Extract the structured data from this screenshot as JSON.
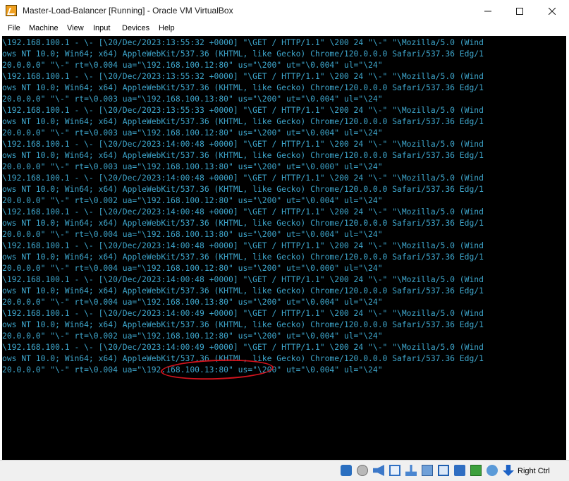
{
  "window": {
    "title": "Master-Load-Balancer [Running] - Oracle VM VirtualBox"
  },
  "menu": [
    "File",
    "Machine",
    "View",
    "Input",
    "Devices",
    "Help"
  ],
  "terminal": {
    "lines": [
      "\\192.168.100.1 - \\- [\\20/Dec/2023:13:55:32 +0000] \"\\GET / HTTP/1.1\" \\200 24 \"\\-\" \"\\Mozilla/5.0 (Wind",
      "ows NT 10.0; Win64; x64) AppleWebKit/537.36 (KHTML, like Gecko) Chrome/120.0.0.0 Safari/537.36 Edg/1",
      "20.0.0.0\" \"\\-\" rt=\\0.004 ua=\"\\192.168.100.12:80\" us=\"\\200\" ut=\"\\0.004\" ul=\"\\24\"",
      "\\192.168.100.1 - \\- [\\20/Dec/2023:13:55:32 +0000] \"\\GET / HTTP/1.1\" \\200 24 \"\\-\" \"\\Mozilla/5.0 (Wind",
      "ows NT 10.0; Win64; x64) AppleWebKit/537.36 (KHTML, like Gecko) Chrome/120.0.0.0 Safari/537.36 Edg/1",
      "20.0.0.0\" \"\\-\" rt=\\0.003 ua=\"\\192.168.100.13:80\" us=\"\\200\" ut=\"\\0.004\" ul=\"\\24\"",
      "\\192.168.100.1 - \\- [\\20/Dec/2023:13:55:33 +0000] \"\\GET / HTTP/1.1\" \\200 24 \"\\-\" \"\\Mozilla/5.0 (Wind",
      "ows NT 10.0; Win64; x64) AppleWebKit/537.36 (KHTML, like Gecko) Chrome/120.0.0.0 Safari/537.36 Edg/1",
      "20.0.0.0\" \"\\-\" rt=\\0.003 ua=\"\\192.168.100.12:80\" us=\"\\200\" ut=\"\\0.004\" ul=\"\\24\"",
      "\\192.168.100.1 - \\- [\\20/Dec/2023:14:00:48 +0000] \"\\GET / HTTP/1.1\" \\200 24 \"\\-\" \"\\Mozilla/5.0 (Wind",
      "ows NT 10.0; Win64; x64) AppleWebKit/537.36 (KHTML, like Gecko) Chrome/120.0.0.0 Safari/537.36 Edg/1",
      "20.0.0.0\" \"\\-\" rt=\\0.003 ua=\"\\192.168.100.13:80\" us=\"\\200\" ut=\"\\0.000\" ul=\"\\24\"",
      "\\192.168.100.1 - \\- [\\20/Dec/2023:14:00:48 +0000] \"\\GET / HTTP/1.1\" \\200 24 \"\\-\" \"\\Mozilla/5.0 (Wind",
      "ows NT 10.0; Win64; x64) AppleWebKit/537.36 (KHTML, like Gecko) Chrome/120.0.0.0 Safari/537.36 Edg/1",
      "20.0.0.0\" \"\\-\" rt=\\0.002 ua=\"\\192.168.100.12:80\" us=\"\\200\" ut=\"\\0.004\" ul=\"\\24\"",
      "\\192.168.100.1 - \\- [\\20/Dec/2023:14:00:48 +0000] \"\\GET / HTTP/1.1\" \\200 24 \"\\-\" \"\\Mozilla/5.0 (Wind",
      "ows NT 10.0; Win64; x64) AppleWebKit/537.36 (KHTML, like Gecko) Chrome/120.0.0.0 Safari/537.36 Edg/1",
      "20.0.0.0\" \"\\-\" rt=\\0.004 ua=\"\\192.168.100.13:80\" us=\"\\200\" ut=\"\\0.004\" ul=\"\\24\"",
      "\\192.168.100.1 - \\- [\\20/Dec/2023:14:00:48 +0000] \"\\GET / HTTP/1.1\" \\200 24 \"\\-\" \"\\Mozilla/5.0 (Wind",
      "ows NT 10.0; Win64; x64) AppleWebKit/537.36 (KHTML, like Gecko) Chrome/120.0.0.0 Safari/537.36 Edg/1",
      "20.0.0.0\" \"\\-\" rt=\\0.004 ua=\"\\192.168.100.12:80\" us=\"\\200\" ut=\"\\0.000\" ul=\"\\24\"",
      "\\192.168.100.1 - \\- [\\20/Dec/2023:14:00:48 +0000] \"\\GET / HTTP/1.1\" \\200 24 \"\\-\" \"\\Mozilla/5.0 (Wind",
      "ows NT 10.0; Win64; x64) AppleWebKit/537.36 (KHTML, like Gecko) Chrome/120.0.0.0 Safari/537.36 Edg/1",
      "20.0.0.0\" \"\\-\" rt=\\0.004 ua=\"\\192.168.100.13:80\" us=\"\\200\" ut=\"\\0.004\" ul=\"\\24\"",
      "\\192.168.100.1 - \\- [\\20/Dec/2023:14:00:49 +0000] \"\\GET / HTTP/1.1\" \\200 24 \"\\-\" \"\\Mozilla/5.0 (Wind",
      "ows NT 10.0; Win64; x64) AppleWebKit/537.36 (KHTML, like Gecko) Chrome/120.0.0.0 Safari/537.36 Edg/1",
      "20.0.0.0\" \"\\-\" rt=\\0.002 ua=\"\\192.168.100.12:80\" us=\"\\200\" ut=\"\\0.004\" ul=\"\\24\"",
      "\\192.168.100.1 - \\- [\\20/Dec/2023:14:00:49 +0000] \"\\GET / HTTP/1.1\" \\200 24 \"\\-\" \"\\Mozilla/5.0 (Wind",
      "ows NT 10.0; Win64; x64) AppleWebKit/537.36 (KHTML, like Gecko) Chrome/120.0.0.0 Safari/537.36 Edg/1",
      "20.0.0.0\" \"\\-\" rt=\\0.004 ua=\"\\192.168.100.13:80\" us=\"\\200\" ut=\"\\0.004\" ul=\"\\24\""
    ]
  },
  "statusbar": {
    "host_key": "Right Ctrl",
    "icons": [
      "hard-disk-icon",
      "optical-drive-icon",
      "audio-icon",
      "network-icon",
      "usb-icon",
      "shared-folders-icon",
      "display-icon",
      "recording-icon",
      "cpu-icon",
      "mouse-integration-icon",
      "keyboard-capture-icon"
    ]
  },
  "colors": {
    "terminal_text": "#3ea6cc",
    "terminal_bg": "#000000",
    "highlight": "#d2141e"
  }
}
